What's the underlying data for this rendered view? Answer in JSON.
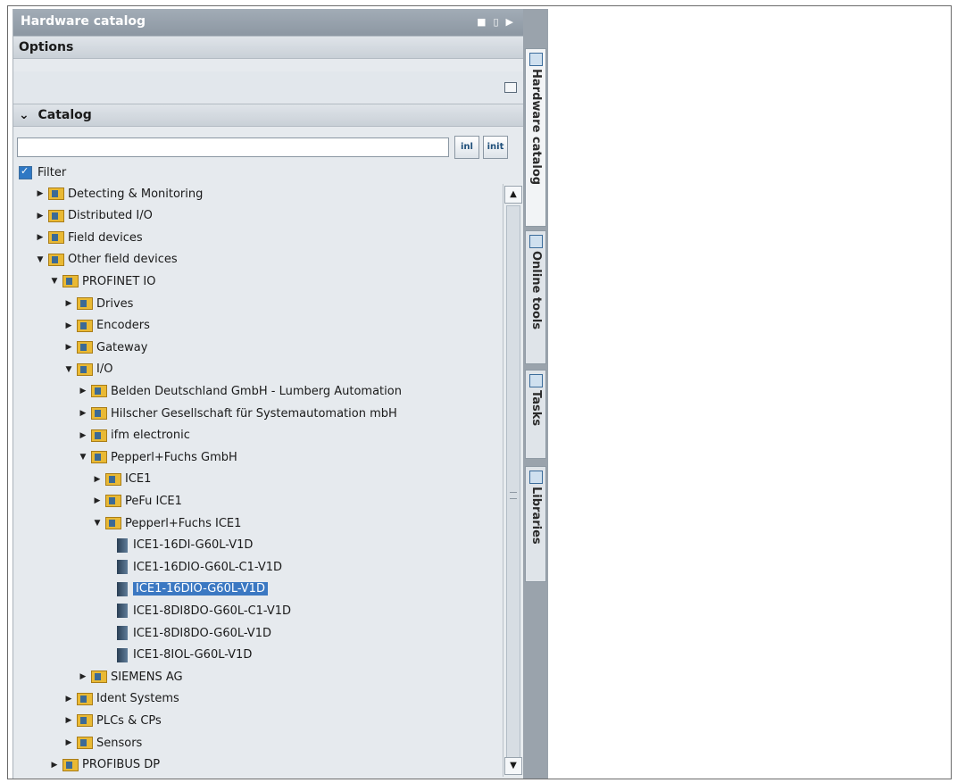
{
  "panel": {
    "title": "Hardware catalog",
    "options_label": "Options",
    "catalog_label": "Catalog",
    "search": {
      "value": "",
      "placeholder": ""
    },
    "search_buttons": [
      "inl",
      "init"
    ],
    "filter_label": "Filter",
    "filter_checked": true
  },
  "tree": [
    {
      "label": "Detecting & Monitoring",
      "level": 0,
      "state": "collapsed",
      "type": "folder"
    },
    {
      "label": "Distributed I/O",
      "level": 0,
      "state": "collapsed",
      "type": "folder"
    },
    {
      "label": "Field devices",
      "level": 0,
      "state": "collapsed",
      "type": "folder"
    },
    {
      "label": "Other field devices",
      "level": 0,
      "state": "expanded",
      "type": "folder"
    },
    {
      "label": "PROFINET IO",
      "level": 1,
      "state": "expanded",
      "type": "folder"
    },
    {
      "label": "Drives",
      "level": 2,
      "state": "collapsed",
      "type": "folder"
    },
    {
      "label": "Encoders",
      "level": 2,
      "state": "collapsed",
      "type": "folder"
    },
    {
      "label": "Gateway",
      "level": 2,
      "state": "collapsed",
      "type": "folder"
    },
    {
      "label": "I/O",
      "level": 2,
      "state": "expanded",
      "type": "folder"
    },
    {
      "label": "Belden Deutschland GmbH - Lumberg Automation",
      "level": 3,
      "state": "collapsed",
      "type": "folder"
    },
    {
      "label": "Hilscher Gesellschaft für Systemautomation mbH",
      "level": 3,
      "state": "collapsed",
      "type": "folder"
    },
    {
      "label": "ifm electronic",
      "level": 3,
      "state": "collapsed",
      "type": "folder"
    },
    {
      "label": "Pepperl+Fuchs GmbH",
      "level": 3,
      "state": "expanded",
      "type": "folder"
    },
    {
      "label": "ICE1",
      "level": 4,
      "state": "collapsed",
      "type": "folder"
    },
    {
      "label": "PeFu ICE1",
      "level": 4,
      "state": "collapsed",
      "type": "folder"
    },
    {
      "label": "Pepperl+Fuchs ICE1",
      "level": 4,
      "state": "expanded",
      "type": "folder"
    },
    {
      "label": "ICE1-16DI-G60L-V1D",
      "level": 5,
      "state": "none",
      "type": "device"
    },
    {
      "label": "ICE1-16DIO-G60L-C1-V1D",
      "level": 5,
      "state": "none",
      "type": "device"
    },
    {
      "label": "ICE1-16DIO-G60L-V1D",
      "level": 5,
      "state": "none",
      "type": "device",
      "selected": true
    },
    {
      "label": "ICE1-8DI8DO-G60L-C1-V1D",
      "level": 5,
      "state": "none",
      "type": "device"
    },
    {
      "label": "ICE1-8DI8DO-G60L-V1D",
      "level": 5,
      "state": "none",
      "type": "device"
    },
    {
      "label": "ICE1-8IOL-G60L-V1D",
      "level": 5,
      "state": "none",
      "type": "device"
    },
    {
      "label": "SIEMENS AG",
      "level": 3,
      "state": "collapsed",
      "type": "folder"
    },
    {
      "label": "Ident Systems",
      "level": 2,
      "state": "collapsed",
      "type": "folder"
    },
    {
      "label": "PLCs & CPs",
      "level": 2,
      "state": "collapsed",
      "type": "folder"
    },
    {
      "label": "Sensors",
      "level": 2,
      "state": "collapsed",
      "type": "folder"
    },
    {
      "label": "PROFIBUS DP",
      "level": 1,
      "state": "collapsed",
      "type": "folder"
    }
  ],
  "side_tabs": [
    {
      "label": "Hardware catalog",
      "active": true,
      "icon": "catalog-icon"
    },
    {
      "label": "Online tools",
      "active": false,
      "icon": "online-tools-icon"
    },
    {
      "label": "Tasks",
      "active": false,
      "icon": "tasks-icon"
    },
    {
      "label": "Libraries",
      "active": false,
      "icon": "libraries-icon"
    }
  ],
  "colors": {
    "selection": "#3b78c2",
    "titlebar": "#98a2ac",
    "folder": "#e9b934"
  }
}
